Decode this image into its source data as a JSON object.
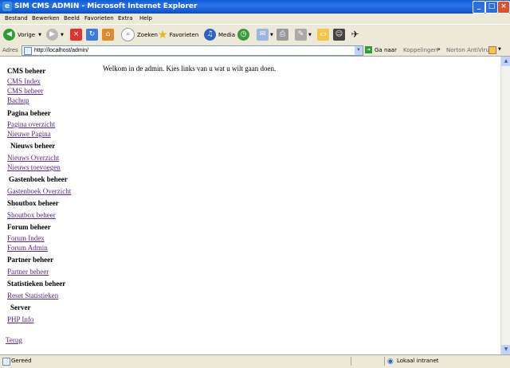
{
  "window": {
    "title": "SIM CMS ADMIN - Microsoft Internet Explorer"
  },
  "menu": [
    "Bestand",
    "Bewerken",
    "Beeld",
    "Favorieten",
    "Extra",
    "Help"
  ],
  "toolbar": {
    "back": "Vorige",
    "search": "Zoeken",
    "favorites": "Favorieten",
    "media": "Media"
  },
  "address": {
    "label": "Adres",
    "url": "http://localhost/admin/",
    "go": "Ga naar",
    "links": "Koppelingen",
    "norton": "Norton AntiVirus"
  },
  "page": {
    "welcome": "Welkom in de admin. Kies links van u wat u wilt gaan doen.",
    "sections": [
      {
        "title": "CMS beheer",
        "links": [
          "CMS Index",
          "CMS beheer",
          "Bachup"
        ]
      },
      {
        "title": "Pagina beheer",
        "links": [
          "Pagina overzicht",
          "Nieuwe Pagina"
        ]
      },
      {
        "title": "Nieuws beheer",
        "links": [
          "Nieuws Overzicht",
          "Nieuws toevoegen"
        ]
      },
      {
        "title": "Gastenboek beheer",
        "links": [
          "Gastenboek Overzicht"
        ]
      },
      {
        "title": "Shoutbox beheer",
        "links": [
          "Shoutbox beheer"
        ]
      },
      {
        "title": "Forum beheer",
        "links": [
          "Forum Index",
          "Forum Admin"
        ]
      },
      {
        "title": "Partner beheer",
        "links": [
          "Partner beheer"
        ]
      },
      {
        "title": "Statistieken beheer",
        "links": [
          "Reset Statistieken"
        ]
      },
      {
        "title": "Server",
        "links": [
          "PHP Info"
        ]
      }
    ],
    "back_link": "Terug"
  },
  "status": {
    "left": "Gereed",
    "zone": "Lokaal intranet"
  },
  "colors": {
    "titlebar": "#0a5bd6",
    "visited_link": "#5b2a86",
    "chrome": "#ece9d8"
  }
}
